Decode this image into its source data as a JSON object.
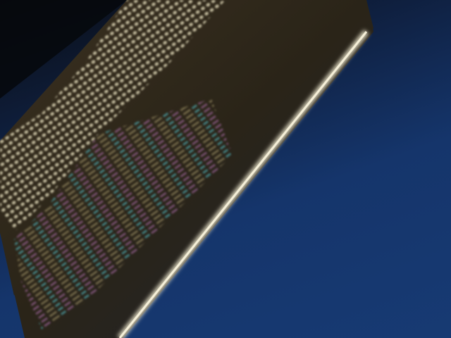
{
  "scene": {
    "description_colors": {
      "background": "#173a73",
      "screen_dark": "#2a2418",
      "screen_text": "#d8d0b0",
      "bezel_highlight": "#e8e2c8",
      "syntax_cyan": "#4fb0b8",
      "syntax_magenta": "#b070b0",
      "syntax_orange": "#c08040"
    }
  },
  "screen": {
    "grid_icon": "terminal-grid-icon",
    "code_icon": "code-listing-icon"
  }
}
